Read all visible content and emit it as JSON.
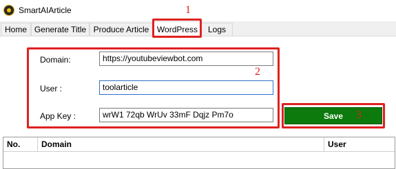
{
  "window": {
    "title": "SmartAIArticle",
    "icon": "app-logo-icon"
  },
  "tabs": [
    {
      "label": "Home",
      "active": false
    },
    {
      "label": "Generate Title",
      "active": false
    },
    {
      "label": "Produce Article",
      "active": false
    },
    {
      "label": "WordPress",
      "active": true
    },
    {
      "label": "Logs",
      "active": false
    }
  ],
  "form": {
    "domain_label": "Domain:",
    "domain_value": "https://youtubeviewbot.com",
    "user_label": "User :",
    "user_value": "toolarticle",
    "appkey_label": "App Key :",
    "appkey_value": "wrW1 72qb WrUv 33mF Dqjz Pm7o"
  },
  "save_button": {
    "label": "Save",
    "color": "#0c7a0c"
  },
  "table": {
    "columns": [
      "No.",
      "Domain",
      "User"
    ],
    "rows": []
  },
  "annotations": {
    "one": "1",
    "two": "2",
    "three": "3",
    "color": "#e02020"
  }
}
